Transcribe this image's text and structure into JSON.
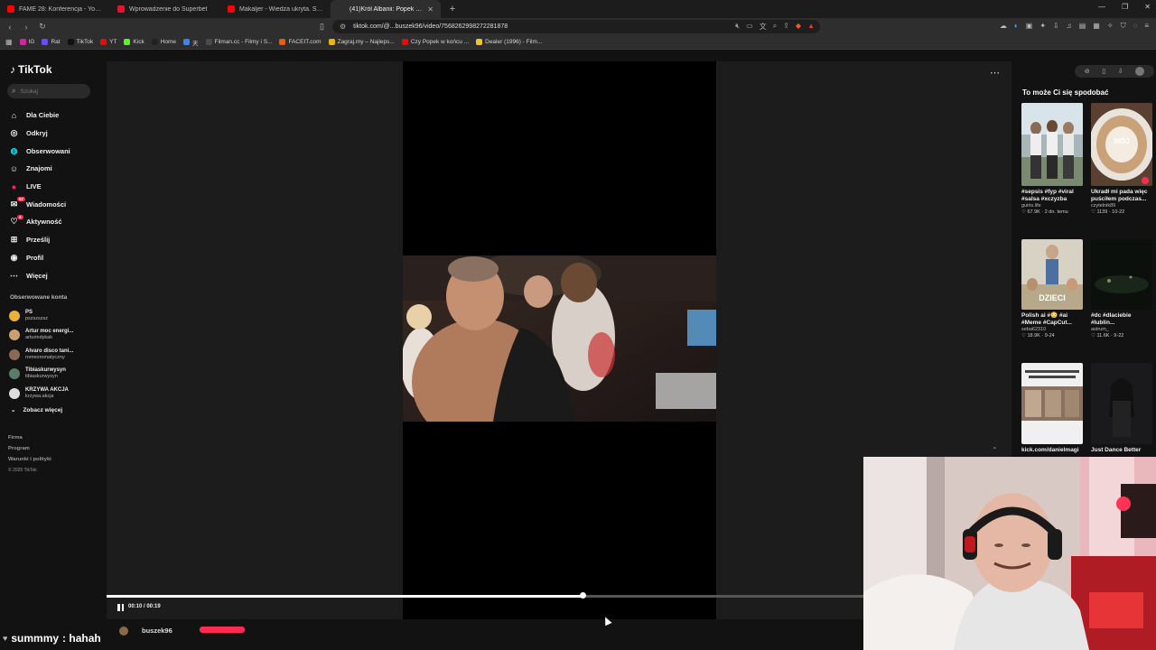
{
  "browser": {
    "tabs": [
      {
        "title": "FAME 28: Konferencja - YouTube",
        "color": "#ff0000",
        "active": false
      },
      {
        "title": "Wprowadzenie do Superbet",
        "color": "#e3132a",
        "active": false
      },
      {
        "title": "Makaljer - Wiedza ukryta. Schizofre...",
        "color": "#ff0000",
        "active": false
      },
      {
        "title": "(41)Król Albanii: Popek w ak...",
        "color": "#2e2e2e",
        "active": true
      }
    ],
    "new_tab": "+",
    "window_controls": [
      "—",
      "❐",
      "✕"
    ],
    "url": "tiktok.com/@...buszek96/video/7568262998272281878",
    "bookmarks": [
      {
        "label": "IG",
        "color": "#d6249f"
      },
      {
        "label": "Rat",
        "color": "#6c4cff"
      },
      {
        "label": "TikTok",
        "color": "#111111"
      },
      {
        "label": "YT",
        "color": "#ff0000"
      },
      {
        "label": "Kick",
        "color": "#53fc18"
      },
      {
        "label": "Home",
        "color": "#222222"
      },
      {
        "label": "天",
        "color": "#3b82f6"
      },
      {
        "label": "Filman.cc - Filmy i S...",
        "color": "#4a4a4a"
      },
      {
        "label": "FACEIT.com",
        "color": "#ff5500"
      },
      {
        "label": "Zagraj.my – Najleps...",
        "color": "#f0b400"
      },
      {
        "label": "Czy Popek w końcu ...",
        "color": "#ff0000"
      },
      {
        "label": "Dealer (1996) - Film...",
        "color": "#f5c518"
      }
    ]
  },
  "sidebar": {
    "logo": "TikTok",
    "search_placeholder": "Szukaj",
    "menu": [
      {
        "label": "Dla Ciebie",
        "icon": "home-icon",
        "glyph": "⌂"
      },
      {
        "label": "Odkryj",
        "icon": "compass-icon",
        "glyph": "◎"
      },
      {
        "label": "Obserwowani",
        "icon": "following-icon",
        "glyph": "◍"
      },
      {
        "label": "Znajomi",
        "icon": "friends-icon",
        "glyph": "☺"
      },
      {
        "label": "LIVE",
        "icon": "live-icon",
        "glyph": "●"
      },
      {
        "label": "Wiadomości",
        "icon": "messages-icon",
        "glyph": "✉",
        "badge": "57"
      },
      {
        "label": "Aktywność",
        "icon": "activity-icon",
        "glyph": "♡",
        "badge": "4"
      },
      {
        "label": "Prześlij",
        "icon": "upload-icon",
        "glyph": "⊞"
      },
      {
        "label": "Profil",
        "icon": "profile-icon",
        "glyph": "◉"
      },
      {
        "label": "Więcej",
        "icon": "more-icon",
        "glyph": "⋯"
      }
    ],
    "following_header": "Obserwowane konta",
    "following": [
      {
        "name": "PS",
        "handle": "pszszszsz",
        "color": "#e8b23a"
      },
      {
        "name": "Artur moc energi...",
        "handle": "arturindykak",
        "color": "#caa070"
      },
      {
        "name": "Alvaro disco tani...",
        "handle": "romeoromatyczny",
        "color": "#8a6a55"
      },
      {
        "name": "Tibiaskurwysyn",
        "handle": "tibiaskurwysyn",
        "color": "#5a7a6a"
      },
      {
        "name": "KRZYWA AKCJA",
        "handle": "krzywa.akcja",
        "color": "#dddddd"
      }
    ],
    "see_more": "Zobacz więcej",
    "footer": [
      "Firma",
      "Program",
      "Warunki i polityki"
    ],
    "copyright": "© 2025 TikTok"
  },
  "player": {
    "time": "00:10 / 00:19",
    "progress": 0.526,
    "author": "buszek96"
  },
  "recommendations": {
    "title": "To może Ci się spodobać",
    "items": [
      {
        "caption": "#sepsis #fyp #viral #salsa #xczyzba",
        "author": "guiris.life",
        "meta": "♡ 67.9K · 2 dn. temu"
      },
      {
        "caption": "Ukradł mi pada więc puściłem podczas...",
        "author": "czytelnik89",
        "meta": "♡ 1139 · 10-22",
        "overlay": "MÓJ"
      },
      {
        "caption": "Polish ai #😳 #ai #Meme #CapCut...",
        "author": "seba62310",
        "meta": "♡ 18.9K · 9-24",
        "overlay": "DZIECI"
      },
      {
        "caption": "#dc #dlaciebie #lublin...",
        "author": "astrum_",
        "meta": "♡ 11.6K · 9-22"
      },
      {
        "caption": "kick.com/danielmagi",
        "author": "",
        "meta": ""
      },
      {
        "caption": "Just Dance Better",
        "author": "",
        "meta": ""
      }
    ]
  },
  "chat": {
    "user": "summmy",
    "message": ": hahah"
  }
}
